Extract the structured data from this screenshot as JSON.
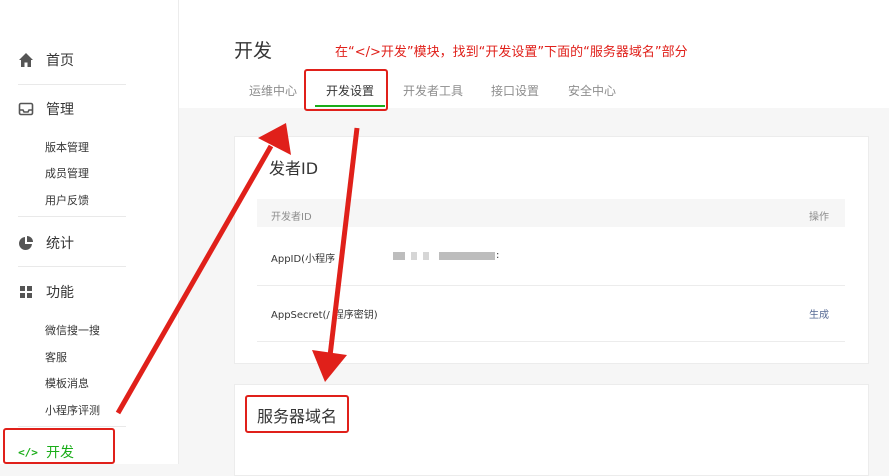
{
  "sidebar": {
    "home": {
      "label": "首页"
    },
    "manage": {
      "label": "管理",
      "items": [
        "版本管理",
        "成员管理",
        "用户反馈"
      ]
    },
    "stats": {
      "label": "统计"
    },
    "features": {
      "label": "功能",
      "items": [
        "微信搜一搜",
        "客服",
        "模板消息",
        "小程序评测"
      ]
    },
    "dev": {
      "label": "开发"
    }
  },
  "main": {
    "title": "开发",
    "tabs": [
      "运维中心",
      "开发设置",
      "开发者工具",
      "接口设置",
      "安全中心"
    ],
    "active_tab": "开发设置",
    "dev_id_card": {
      "title": "开发者ID",
      "title_visible_text": "发者ID",
      "head_left": "开发者ID",
      "head_right": "操作",
      "rows": [
        {
          "label": "AppID(小程序ID)",
          "visible_label": "AppID(小程序",
          "value_tail": ":",
          "action": ""
        },
        {
          "label": "AppSecret(小程序密钥)",
          "visible_label": "AppSecret(/",
          "visible_label_tail": "程序密钥)",
          "action": "生成"
        }
      ]
    },
    "server_card": {
      "title": "服务器域名"
    }
  },
  "annotation": {
    "text": "在“</>开发”模块，找到“开发设置”下面的“服务器域名”部分"
  },
  "colors": {
    "accent": "#1aad19",
    "annotation": "#e0201a",
    "link": "#576b95"
  }
}
